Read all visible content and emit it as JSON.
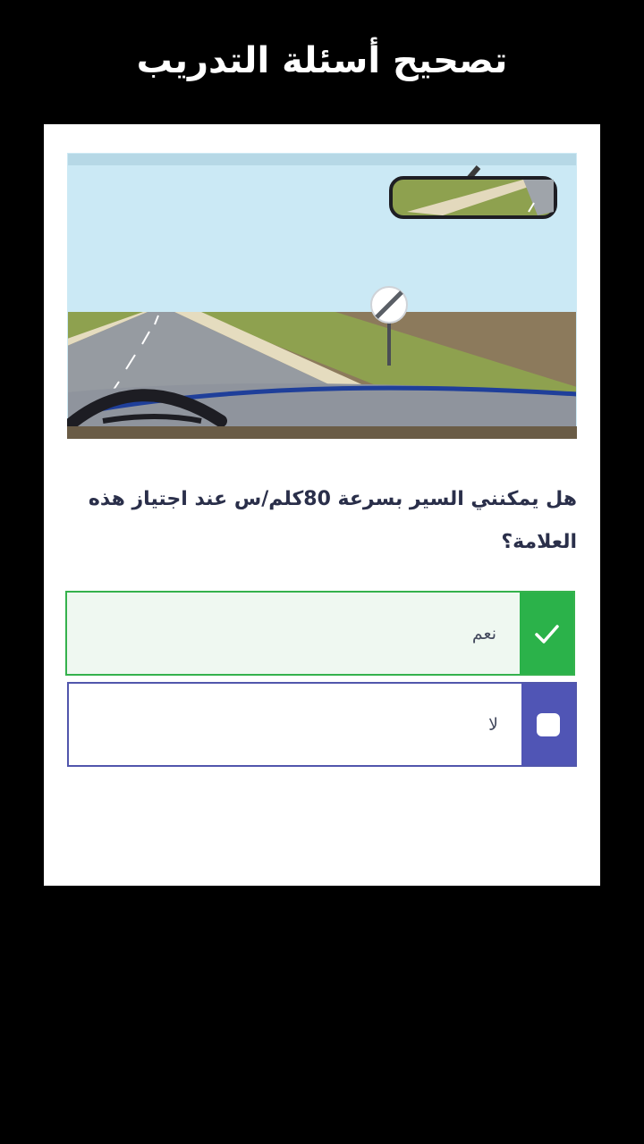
{
  "header": {
    "title": "تصحيح أسئلة التدريب"
  },
  "question": {
    "text": "هل يمكنني السير بسرعة 80كلم/س عند اجتياز هذه العلامة؟"
  },
  "answers": [
    {
      "label": "نعم",
      "state": "correct",
      "icon": "checkmark-icon"
    },
    {
      "label": "لا",
      "state": "unselected",
      "icon": "checkbox-icon"
    }
  ],
  "colors": {
    "correct": "#2bb24a",
    "option": "#5055b5",
    "sky": "#cdeaf5",
    "grass": "#8a9a52"
  }
}
